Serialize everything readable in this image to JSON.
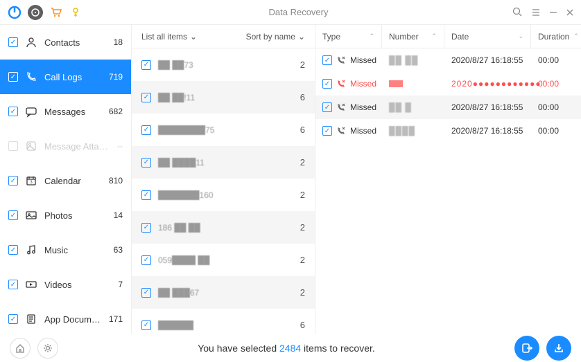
{
  "title": "Data Recovery",
  "sidebar": [
    {
      "icon": "contacts",
      "label": "Contacts",
      "count": "18",
      "checked": true,
      "active": false,
      "disabled": false
    },
    {
      "icon": "calllogs",
      "label": "Call Logs",
      "count": "719",
      "checked": true,
      "active": true,
      "disabled": false
    },
    {
      "icon": "messages",
      "label": "Messages",
      "count": "682",
      "checked": true,
      "active": false,
      "disabled": false
    },
    {
      "icon": "attach",
      "label": "Message Attach...",
      "count": "--",
      "checked": false,
      "active": false,
      "disabled": true
    },
    {
      "icon": "calendar",
      "label": "Calendar",
      "count": "810",
      "checked": true,
      "active": false,
      "disabled": false
    },
    {
      "icon": "photos",
      "label": "Photos",
      "count": "14",
      "checked": true,
      "active": false,
      "disabled": false
    },
    {
      "icon": "music",
      "label": "Music",
      "count": "63",
      "checked": true,
      "active": false,
      "disabled": false
    },
    {
      "icon": "videos",
      "label": "Videos",
      "count": "7",
      "checked": true,
      "active": false,
      "disabled": false
    },
    {
      "icon": "docs",
      "label": "App Documents",
      "count": "171",
      "checked": true,
      "active": false,
      "disabled": false
    }
  ],
  "middle": {
    "list_label": "List all items",
    "sort_label": "Sort by name",
    "rows": [
      {
        "name": "██ ██73",
        "count": "2",
        "alt": false
      },
      {
        "name": "██ ██!11",
        "count": "6",
        "alt": true
      },
      {
        "name": "████████75",
        "count": "6",
        "alt": false
      },
      {
        "name": "██ ████11",
        "count": "2",
        "alt": true
      },
      {
        "name": "███████160",
        "count": "2",
        "alt": false
      },
      {
        "name": "186 ██ ██",
        "count": "2",
        "alt": true
      },
      {
        "name": "059████ ██",
        "count": "2",
        "alt": false
      },
      {
        "name": "██ ███67",
        "count": "2",
        "alt": true
      },
      {
        "name": "██████",
        "count": "6",
        "alt": false
      }
    ]
  },
  "detail": {
    "cols": {
      "type": "Type",
      "number": "Number",
      "date": "Date",
      "duration": "Duration"
    },
    "rows": [
      {
        "type": "Missed",
        "number": "██ ██",
        "date": "2020/8/27 16:18:55",
        "duration": "00:00",
        "alt": false,
        "sel": false
      },
      {
        "type": "Missed",
        "number": "",
        "date": "2020●●●●●●●●●●●●",
        "duration": "00:00",
        "alt": false,
        "sel": true
      },
      {
        "type": "Missed",
        "number": "██ █",
        "date": "2020/8/27 16:18:55",
        "duration": "00:00",
        "alt": true,
        "sel": false
      },
      {
        "type": "Missed",
        "number": "████",
        "date": "2020/8/27 16:18:55",
        "duration": "00:00",
        "alt": false,
        "sel": false
      }
    ]
  },
  "footer": {
    "prefix": "You have selected ",
    "count": "2484",
    "suffix": " items to recover."
  }
}
